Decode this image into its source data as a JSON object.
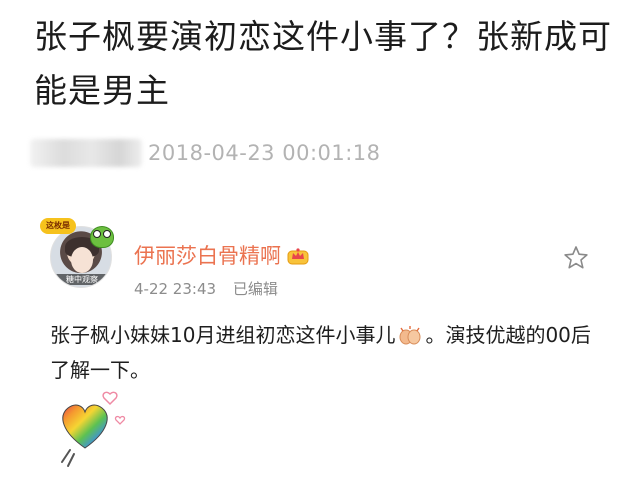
{
  "article": {
    "headline": "张子枫要演初恋这件小事了？张新成可能是男主",
    "timestamp": "2018-04-23 00:01:18"
  },
  "post": {
    "avatar": {
      "sticker_text": "这枚是",
      "caption": "糖中观察"
    },
    "username": "伊丽莎白骨精啊",
    "badge": "crown-badge-icon",
    "time": "4-22 23:43",
    "edited_label": "已编辑",
    "body_part1": "张子枫小妹妹10月进组初恋这件小事儿",
    "body_part2": "。演技优越的00后了解一下。",
    "inline_emoji": "clap-icon",
    "sticker": "rainbow-heart-sticker"
  },
  "colors": {
    "username": "#eb7350",
    "muted": "#8c8c8c",
    "timestamp": "#b3b3b3",
    "text": "#1e1e1e"
  }
}
